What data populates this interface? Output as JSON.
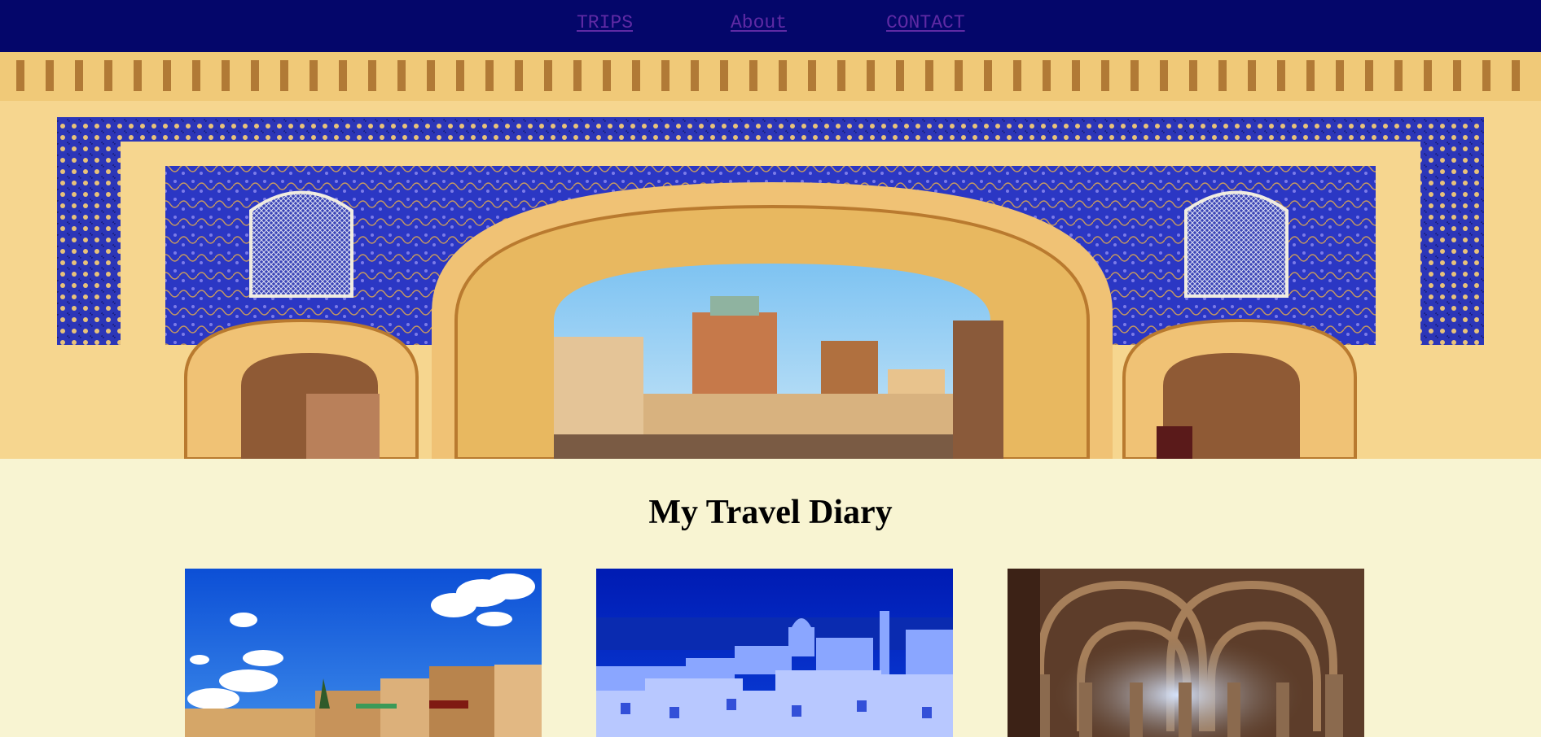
{
  "nav": {
    "items": [
      {
        "label": "TRIPS"
      },
      {
        "label": "About"
      },
      {
        "label": "CONTACT"
      }
    ],
    "background": "#04066a",
    "link_color": "#5f2aa4"
  },
  "hero": {
    "image": "ornate-moroccan-gate-photo"
  },
  "page": {
    "title": "My Travel Diary",
    "background": "#f8f4d2"
  },
  "cards": [
    {
      "image": "moroccan-medina-blue-sky-photo"
    },
    {
      "image": "white-island-town-blue-night-photo"
    },
    {
      "image": "vaulted-stone-cistern-photo"
    }
  ]
}
